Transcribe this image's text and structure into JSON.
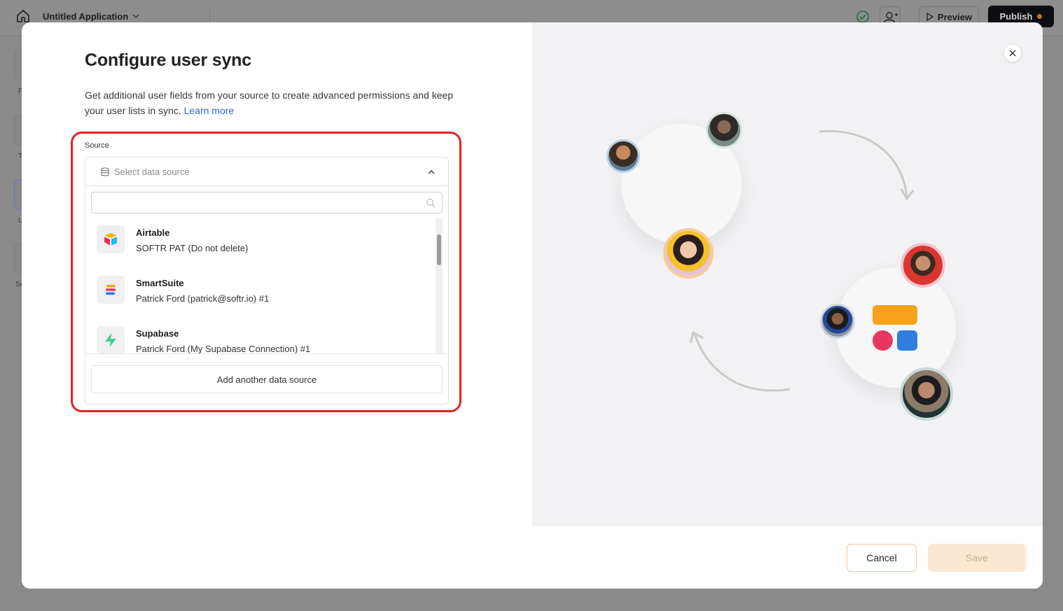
{
  "topbar": {
    "app_title": "Untitled Application",
    "preview_label": "Preview",
    "publish_label": "Publish"
  },
  "sidebar_ghost_labels": [
    "P",
    "T",
    "U",
    "Se"
  ],
  "modal": {
    "title": "Configure user sync",
    "description": "Get additional user fields from your source to create advanced permissions and keep your user lists in sync.",
    "learn_more": "Learn more",
    "source_label": "Source",
    "select_placeholder": "Select data source",
    "search_placeholder": "",
    "sources": [
      {
        "name": "Airtable",
        "detail": "SOFTR PAT (Do not delete)",
        "icon": "airtable-icon"
      },
      {
        "name": "SmartSuite",
        "detail": "Patrick Ford (patrick@softr.io) #1",
        "icon": "smartsuite-icon"
      },
      {
        "name": "Supabase",
        "detail": "Patrick Ford (My Supabase Connection) #1",
        "icon": "supabase-icon"
      }
    ],
    "add_source_label": "Add another data source",
    "cancel_label": "Cancel",
    "save_label": "Save"
  },
  "colors": {
    "highlight": "#e0231c",
    "link": "#2f66d0",
    "save_disabled_bg": "#fbe8d2",
    "tile_orange": "#f6a21c",
    "tile_pink": "#e8375e",
    "tile_blue": "#2f7ee0"
  }
}
